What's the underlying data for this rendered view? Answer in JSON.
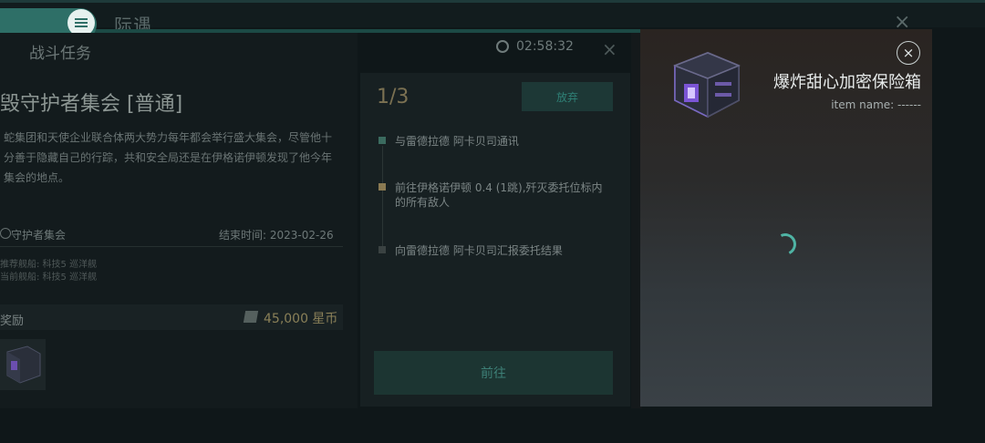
{
  "header": {
    "logo_text": "际遇",
    "close_glyph": "×",
    "menu_icon": "hamburger-menu-icon"
  },
  "mission_panel": {
    "section_title": "战斗任务",
    "timer": "02:58:32",
    "close_glyph": "×",
    "mission_title": "毁守护者集会 [普通]",
    "description": "蛇集团和天使企业联合体两大势力每年都会举行盛大集会，尽管他十分善于隐藏自己的行踪，共和安全局还是在伊格诺伊顿发现了他今年集会的地点。",
    "location": "守护者集会",
    "end_time": "结束时间: 2023-02-26",
    "requirement_1": "推荐舰船: 科技5 巡洋舰",
    "requirement_2": "当前舰船: 科技5 巡洋舰",
    "reward_label": "奖励",
    "reward_amount": "45,000 星币"
  },
  "steps_panel": {
    "progress": "1/3",
    "abandon_label": "放弃",
    "steps": [
      {
        "text": "与雷德拉德 阿卡贝司通讯",
        "status": "done"
      },
      {
        "text": "前往伊格诺伊顿 0.4 (1跳),歼灭委托位标内的所有敌人",
        "status": "current"
      },
      {
        "text": "向雷德拉德 阿卡贝司汇报委托结果",
        "status": "pending"
      }
    ],
    "go_label": "前往"
  },
  "item_popup": {
    "title": "爆炸甜心加密保险箱",
    "subtitle": "item name: ------",
    "close_glyph": "×",
    "loading": true
  },
  "colors": {
    "accent_teal": "#2e6f67",
    "reward_gold": "#8a8058",
    "spinner": "#4fb3a4"
  }
}
